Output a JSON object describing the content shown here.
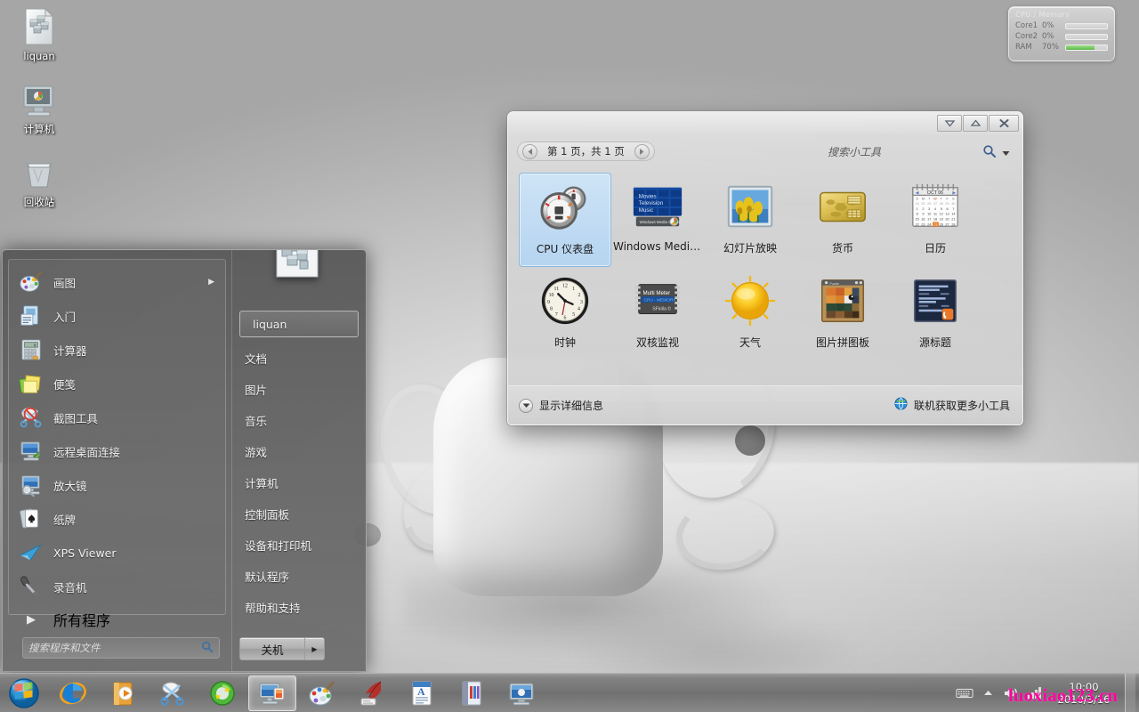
{
  "desktop": {
    "icons": [
      {
        "label": "liquan",
        "icon": "folder-user-icon"
      },
      {
        "label": "计算机",
        "icon": "computer-icon"
      },
      {
        "label": "回收站",
        "icon": "recycle-bin-icon"
      }
    ]
  },
  "cpu_gadget": {
    "title": "CPU / Memory",
    "rows": [
      {
        "name": "Core1",
        "value": "0%",
        "percent": 0
      },
      {
        "name": "Core2",
        "value": "0%",
        "percent": 0
      },
      {
        "name": "RAM",
        "value": "70%",
        "percent": 70
      }
    ],
    "accent": "#5cb84a"
  },
  "gadget_window": {
    "titlebar": {
      "minimize_label": "▽",
      "restore_label": "△",
      "close_label": "✕"
    },
    "pager": {
      "prev_label": "◀",
      "next_label": "▶",
      "text": "第 1 页，共 1 页"
    },
    "search": {
      "placeholder": "搜索小工具",
      "value": ""
    },
    "gadgets": [
      {
        "name": "CPU 仪表盘",
        "icon": "cpu-meter-icon",
        "selected": true
      },
      {
        "name": "Windows Media...",
        "icon": "windows-media-center-icon",
        "selected": false
      },
      {
        "name": "幻灯片放映",
        "icon": "slideshow-icon",
        "selected": false
      },
      {
        "name": "货币",
        "icon": "currency-icon",
        "selected": false
      },
      {
        "name": "日历",
        "icon": "calendar-icon",
        "selected": false
      },
      {
        "name": "时钟",
        "icon": "clock-icon",
        "selected": false
      },
      {
        "name": "双核监视",
        "icon": "multi-meter-icon",
        "selected": false
      },
      {
        "name": "天气",
        "icon": "weather-sun-icon",
        "selected": false
      },
      {
        "name": "图片拼图板",
        "icon": "picture-puzzle-icon",
        "selected": false
      },
      {
        "name": "源标题",
        "icon": "feed-headlines-icon",
        "selected": false
      }
    ],
    "footer": {
      "details_label": "显示详细信息",
      "online_label": "联机获取更多小工具"
    },
    "calendar_icon": {
      "month": "OCT 06",
      "today": "21"
    },
    "wmc_icon_lines": [
      "Movies",
      "Television",
      "Music",
      "Windows Media Center"
    ],
    "multimeter_icon_lines": [
      "Multi Meter",
      "CPU - MEMORY",
      "SFkilla ©"
    ]
  },
  "start_menu": {
    "left_items": [
      {
        "label": "画图",
        "icon": "paint-icon",
        "has_arrow": true
      },
      {
        "label": "入门",
        "icon": "getting-started-icon",
        "has_arrow": false
      },
      {
        "label": "计算器",
        "icon": "calculator-icon",
        "has_arrow": false
      },
      {
        "label": "便笺",
        "icon": "sticky-notes-icon",
        "has_arrow": false
      },
      {
        "label": "截图工具",
        "icon": "snipping-tool-icon",
        "has_arrow": false
      },
      {
        "label": "远程桌面连接",
        "icon": "remote-desktop-icon",
        "has_arrow": false
      },
      {
        "label": "放大镜",
        "icon": "magnifier-icon",
        "has_arrow": false
      },
      {
        "label": "纸牌",
        "icon": "solitaire-icon",
        "has_arrow": false
      },
      {
        "label": "XPS Viewer",
        "icon": "xps-viewer-icon",
        "has_arrow": false
      },
      {
        "label": "录音机",
        "icon": "sound-recorder-icon",
        "has_arrow": false
      }
    ],
    "all_programs_label": "所有程序",
    "search": {
      "placeholder": "搜索程序和文件",
      "value": ""
    },
    "right_items": [
      {
        "label": "liquan",
        "is_user": true
      },
      {
        "label": "文档",
        "is_user": false
      },
      {
        "label": "图片",
        "is_user": false
      },
      {
        "label": "音乐",
        "is_user": false
      },
      {
        "label": "游戏",
        "is_user": false
      },
      {
        "label": "计算机",
        "is_user": false
      },
      {
        "label": "控制面板",
        "is_user": false
      },
      {
        "label": "设备和打印机",
        "is_user": false
      },
      {
        "label": "默认程序",
        "is_user": false
      },
      {
        "label": "帮助和支持",
        "is_user": false
      }
    ],
    "shutdown": {
      "label": "关机",
      "arrow": "▶"
    }
  },
  "taskbar": {
    "start_orb": "windows-start-orb",
    "buttons": [
      {
        "icon": "internet-explorer-icon",
        "active": false
      },
      {
        "icon": "windows-media-player-icon",
        "active": false
      },
      {
        "icon": "snipping-tool-icon",
        "active": false
      },
      {
        "icon": "green-refresh-icon",
        "active": false
      },
      {
        "icon": "desktop-gadgets-icon",
        "active": true
      },
      {
        "icon": "paint-icon",
        "active": false
      },
      {
        "icon": "feather-ink-icon",
        "active": false
      },
      {
        "icon": "wordpad-document-icon",
        "active": false
      },
      {
        "icon": "book-icon",
        "active": false
      },
      {
        "icon": "computer-window-icon",
        "active": false
      }
    ],
    "tray": {
      "keyboard_icon": "keyboard-icon",
      "show_hidden_icon": "chevron-up-icon",
      "volume_icon": "volume-icon",
      "network_icon": "network-icon"
    },
    "clock": {
      "time": "10:00",
      "date": "2010/3/16"
    }
  },
  "watermark": {
    "text": "luoxiao123.cn",
    "color": "#ff00a0"
  }
}
